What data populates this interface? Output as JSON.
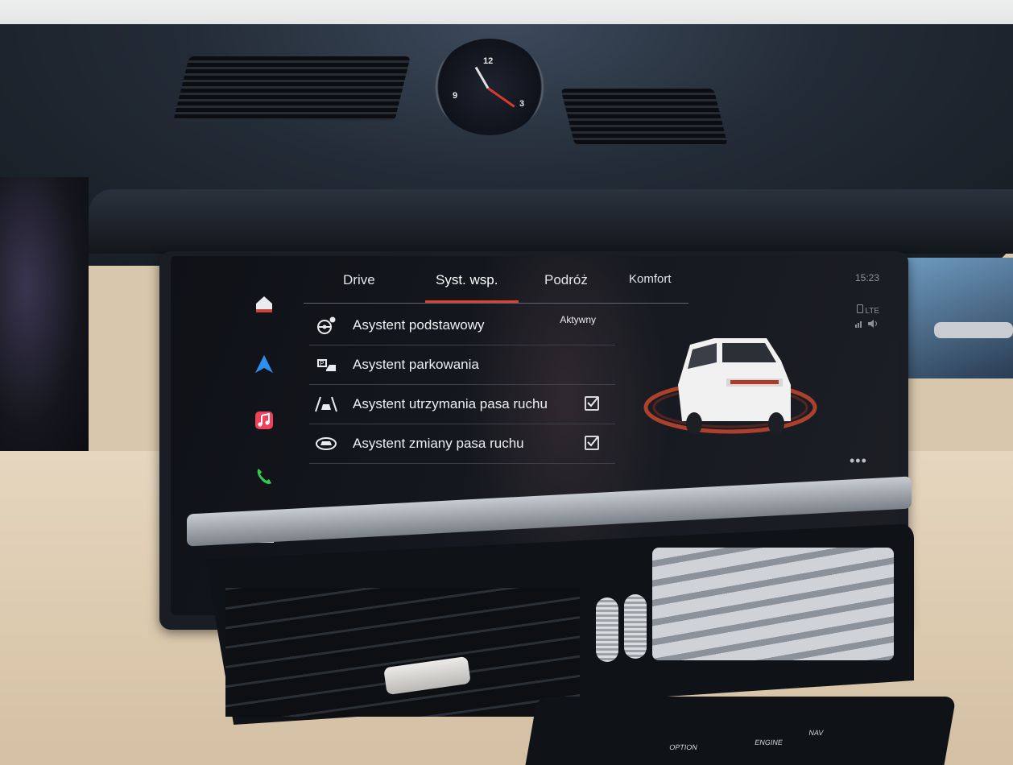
{
  "tabs": [
    {
      "label": "Drive"
    },
    {
      "label": "Syst. wsp."
    },
    {
      "label": "Podróż"
    },
    {
      "label": "Komfort"
    }
  ],
  "active_tab": "Syst. wsp.",
  "status": {
    "time": "15:23",
    "network": "LTE"
  },
  "sidebar": {
    "items": [
      {
        "icon": "home-icon"
      },
      {
        "icon": "navigation-icon"
      },
      {
        "icon": "music-icon"
      },
      {
        "icon": "phone-icon"
      },
      {
        "icon": "car-icon"
      }
    ]
  },
  "assist_list": [
    {
      "label": "Asystent podstawowy",
      "state": "Aktywny",
      "icon": "driver-assist-icon"
    },
    {
      "label": "Asystent parkowania",
      "icon": "parking-assist-icon"
    },
    {
      "label": "Asystent utrzymania pasa ruchu",
      "checked": true,
      "icon": "lane-keep-icon"
    },
    {
      "label": "Asystent zmiany pasa ruchu",
      "checked": true,
      "icon": "lane-change-icon"
    }
  ],
  "colors": {
    "accent": "#e0402f",
    "screen_bg": "#14171d",
    "text": "#eef0f3"
  },
  "gauge": {
    "numbers": [
      "12",
      "3",
      "9"
    ]
  },
  "console": {
    "labels": [
      "OPTION",
      "ENGINE",
      "NAV"
    ]
  }
}
